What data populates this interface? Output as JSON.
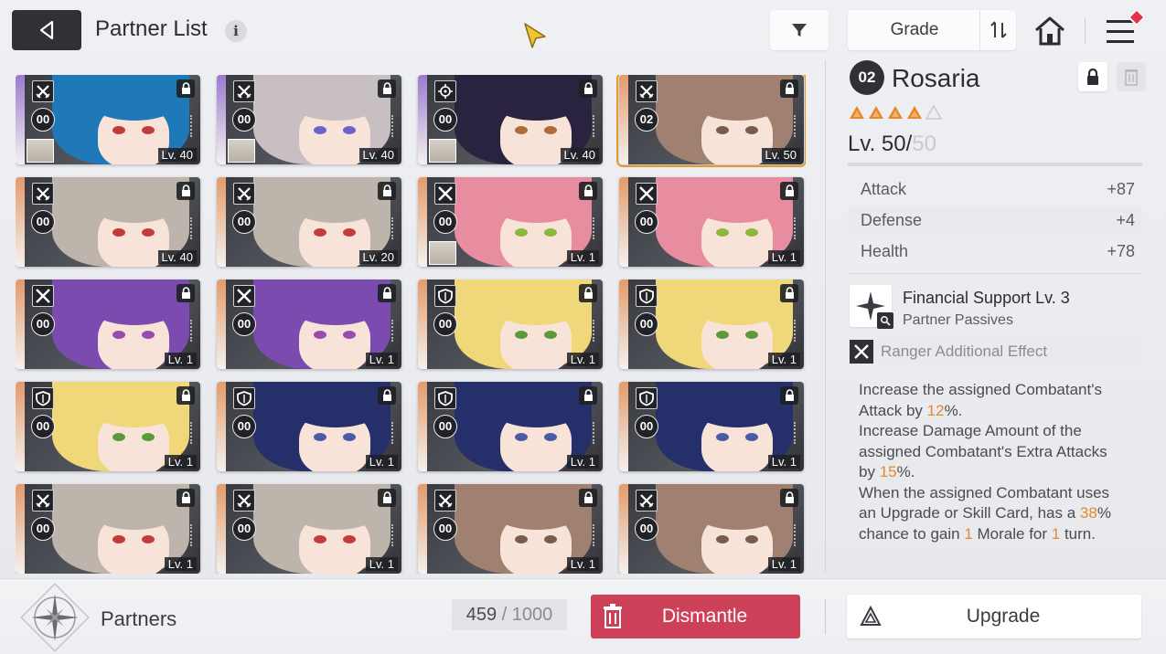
{
  "header": {
    "title": "Partner List",
    "info_icon": "i",
    "sort_label": "Grade"
  },
  "cards": [
    {
      "plus": "00",
      "level": "Lv. 40",
      "strip": "#9b7ad0",
      "hair": "#1f78b8",
      "eye": "#c23b3b",
      "class": "sword",
      "mini": true,
      "selected": false
    },
    {
      "plus": "00",
      "level": "Lv. 40",
      "strip": "#9b7ad0",
      "hair": "#c8bfc3",
      "eye": "#6b63c9",
      "class": "sword",
      "mini": true,
      "selected": false
    },
    {
      "plus": "00",
      "level": "Lv. 40",
      "strip": "#9b7ad0",
      "hair": "#2a2340",
      "eye": "#b06a3a",
      "class": "target",
      "mini": true,
      "selected": false
    },
    {
      "plus": "02",
      "level": "Lv. 50",
      "strip": "#e59a6b",
      "hair": "#a08070",
      "eye": "#7a5a48",
      "class": "sword",
      "mini": false,
      "selected": true
    },
    {
      "plus": "00",
      "level": "Lv. 40",
      "strip": "#e59a6b",
      "hair": "#bdb5ac",
      "eye": "#c23b3b",
      "class": "sword",
      "mini": false,
      "selected": false
    },
    {
      "plus": "00",
      "level": "Lv. 20",
      "strip": "#e59a6b",
      "hair": "#bdb5ac",
      "eye": "#c23b3b",
      "class": "sword",
      "mini": false,
      "selected": false
    },
    {
      "plus": "00",
      "level": "Lv. 1",
      "strip": "#e59a6b",
      "hair": "#e88da0",
      "eye": "#8ab83a",
      "class": "crossed",
      "mini": true,
      "selected": false
    },
    {
      "plus": "00",
      "level": "Lv. 1",
      "strip": "#e59a6b",
      "hair": "#e88da0",
      "eye": "#8ab83a",
      "class": "crossed",
      "mini": false,
      "selected": false
    },
    {
      "plus": "00",
      "level": "Lv. 1",
      "strip": "#e59a6b",
      "hair": "#7b4bb0",
      "eye": "#9a4bb0",
      "class": "crossed",
      "mini": false,
      "selected": false
    },
    {
      "plus": "00",
      "level": "Lv. 1",
      "strip": "#e59a6b",
      "hair": "#7b4bb0",
      "eye": "#9a4bb0",
      "class": "crossed",
      "mini": false,
      "selected": false
    },
    {
      "plus": "00",
      "level": "Lv. 1",
      "strip": "#e59a6b",
      "hair": "#f0d87a",
      "eye": "#5a9a3a",
      "class": "shield",
      "mini": false,
      "selected": false
    },
    {
      "plus": "00",
      "level": "Lv. 1",
      "strip": "#e59a6b",
      "hair": "#f0d87a",
      "eye": "#5a9a3a",
      "class": "shield",
      "mini": false,
      "selected": false
    },
    {
      "plus": "00",
      "level": "Lv. 1",
      "strip": "#e59a6b",
      "hair": "#f0d87a",
      "eye": "#5a9a3a",
      "class": "shield",
      "mini": false,
      "selected": false
    },
    {
      "plus": "00",
      "level": "Lv. 1",
      "strip": "#e59a6b",
      "hair": "#25306a",
      "eye": "#4a5aa8",
      "class": "shield",
      "mini": false,
      "selected": false
    },
    {
      "plus": "00",
      "level": "Lv. 1",
      "strip": "#e59a6b",
      "hair": "#25306a",
      "eye": "#4a5aa8",
      "class": "shield",
      "mini": false,
      "selected": false
    },
    {
      "plus": "00",
      "level": "Lv. 1",
      "strip": "#e59a6b",
      "hair": "#25306a",
      "eye": "#4a5aa8",
      "class": "shield",
      "mini": false,
      "selected": false
    },
    {
      "plus": "00",
      "level": "Lv. 1",
      "strip": "#e59a6b",
      "hair": "#bdb5ac",
      "eye": "#c23b3b",
      "class": "sword",
      "mini": false,
      "selected": false
    },
    {
      "plus": "00",
      "level": "Lv. 1",
      "strip": "#e59a6b",
      "hair": "#bdb5ac",
      "eye": "#c23b3b",
      "class": "sword",
      "mini": false,
      "selected": false
    },
    {
      "plus": "00",
      "level": "Lv. 1",
      "strip": "#e59a6b",
      "hair": "#a08070",
      "eye": "#7a5a48",
      "class": "sword",
      "mini": false,
      "selected": false
    },
    {
      "plus": "00",
      "level": "Lv. 1",
      "strip": "#e59a6b",
      "hair": "#a08070",
      "eye": "#7a5a48",
      "class": "sword",
      "mini": false,
      "selected": false
    }
  ],
  "detail": {
    "grade": "02",
    "name": "Rosaria",
    "stars_filled": 4,
    "stars_total": 5,
    "level_current": "Lv. 50/",
    "level_max": "50",
    "stats": [
      {
        "label": "Attack",
        "value": "+87"
      },
      {
        "label": "Defense",
        "value": "+4"
      },
      {
        "label": "Health",
        "value": "+78"
      }
    ],
    "skill_name": "Financial Support Lv. 3",
    "skill_type": "Partner Passives",
    "effect_label": "Ranger Additional Effect",
    "desc": {
      "l1a": "Increase the assigned Combatant's",
      "l2a": "Attack by ",
      "l2v": "12",
      "l2b": "%.",
      "l3a": "Increase Damage Amount of the",
      "l4a": "assigned Combatant's Extra Attacks",
      "l5a": "by ",
      "l5v": "15",
      "l5b": "%.",
      "l6a": "When the assigned Combatant uses",
      "l7a": "an Upgrade or Skill Card, has a ",
      "l7v": "38",
      "l7b": "%",
      "l8a": "chance to gain ",
      "l8v": "1",
      "l8b": " Morale for ",
      "l8v2": "1",
      "l8c": " turn."
    }
  },
  "bottom": {
    "section_label": "Partners",
    "count_current": "459",
    "count_sep": " / ",
    "count_max": "1000",
    "dismantle_label": "Dismantle",
    "upgrade_label": "Upgrade"
  },
  "colors": {
    "accent_orange": "#e58a2b",
    "dismantle_red": "#cc4058",
    "dark": "#2f3136"
  }
}
